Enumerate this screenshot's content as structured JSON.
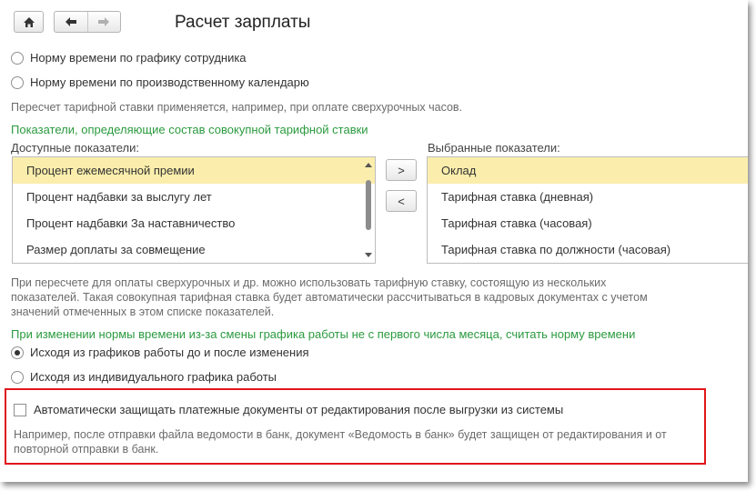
{
  "toolbar": {
    "home_icon": "home-icon",
    "back_icon": "arrow-left-icon",
    "forward_icon": "arrow-right-icon"
  },
  "page": {
    "title": "Расчет зарплаты"
  },
  "norm_options": {
    "option1": "Норму времени по графику сотрудника",
    "option2": "Норму времени по производственному календарю",
    "hint": "Пересчет тарифной ставки применяется, например, при оплате сверхурочных часов."
  },
  "indicators": {
    "section_title": "Показатели, определяющие состав совокупной тарифной ставки",
    "available_label": "Доступные показатели:",
    "selected_label": "Выбранные показатели:",
    "available": [
      "Процент ежемесячной премии",
      "Процент надбавки за выслугу лет",
      "Процент надбавки За наставничество",
      "Размер доплаты за совмещение"
    ],
    "selected": [
      "Оклад",
      "Тарифная ставка (дневная)",
      "Тарифная ставка (часовая)",
      "Тарифная ставка по должности (часовая)"
    ],
    "add_button": ">",
    "remove_button": "<",
    "hint_line1": "При пересчете для оплаты сверхурочных и др. можно использовать тарифную ставку, состоящую из нескольких",
    "hint_line2": "показателей. Такая совокупная тарифная ставка будет автоматически рассчитываться в кадровых документах с учетом",
    "hint_line3": "значений отмеченных в этом списке показателей."
  },
  "schedule_change": {
    "section_title": "При изменении нормы времени из-за смены графика работы не с первого числа месяца, считать норму времени",
    "option1": "Исходя из графиков работы до и после изменения",
    "option2": "Исходя из индивидуального графика работы"
  },
  "protection": {
    "checkbox_label": "Автоматически защищать платежные документы от редактирования после выгрузки из системы",
    "hint_line1": "Например, после отправки файла ведомости в банк, документ «Ведомость в банк» будет защищен от редактирования и от",
    "hint_line2": "повторной отправки в банк."
  },
  "colors": {
    "section_green": "#2a9a3e",
    "selection_yellow": "#fbeeac",
    "highlight_red": "#e0161a"
  }
}
